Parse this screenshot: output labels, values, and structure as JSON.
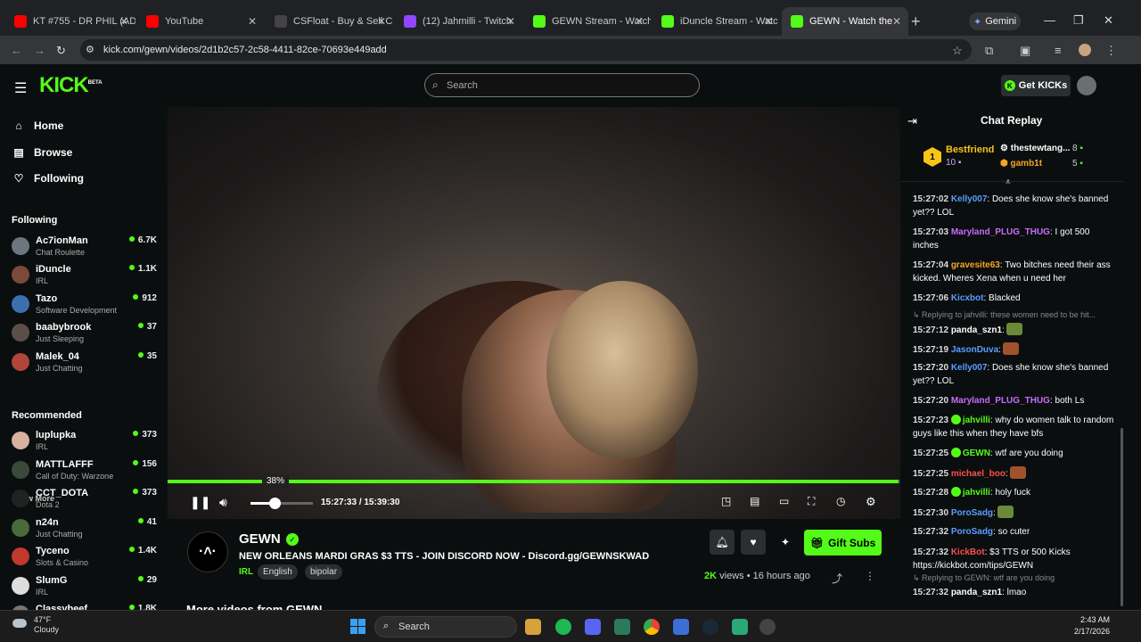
{
  "browser": {
    "tabs": [
      {
        "title": "KT #755 - DR PHIL (AD",
        "fav": "#ff0000"
      },
      {
        "title": "YouTube",
        "fav": "#ff0000"
      },
      {
        "title": "CSFloat - Buy & Sell CS",
        "fav": "#444444"
      },
      {
        "title": "(12) Jahmilli - Twitch",
        "fav": "#9146ff"
      },
      {
        "title": "GEWN Stream - Watch",
        "fav": "#53fc18"
      },
      {
        "title": "iDuncle Stream - Watc",
        "fav": "#53fc18"
      },
      {
        "title": "GEWN - Watch the",
        "fav": "#53fc18"
      }
    ],
    "gemini_label": "Gemini",
    "url": "kick.com/gewn/videos/2d1b2c57-2c58-4411-82ce-70693e449add"
  },
  "kick": {
    "logo": "KICK",
    "logo_beta": "BETA",
    "search_placeholder": "Search",
    "get_kicks_label": "Get KICKs",
    "brand_color": "#53fc18"
  },
  "sidebar": {
    "nav": [
      {
        "label": "Home",
        "icon": "home-icon"
      },
      {
        "label": "Browse",
        "icon": "browse-icon"
      },
      {
        "label": "Following",
        "icon": "heart-icon"
      }
    ],
    "following_header": "Following",
    "following": [
      {
        "name": "Ac7ionMan",
        "category": "Chat Roulette",
        "viewers": "6.7K",
        "color": "#6d7680"
      },
      {
        "name": "iDuncle",
        "category": "IRL",
        "viewers": "1.1K",
        "color": "#7a4b3a"
      },
      {
        "name": "Tazo",
        "category": "Software Development",
        "viewers": "912",
        "color": "#3d6fb0"
      },
      {
        "name": "baabybrook",
        "category": "Just Sleeping",
        "viewers": "37",
        "color": "#5a5048"
      },
      {
        "name": "Malek_04",
        "category": "Just Chatting",
        "viewers": "35",
        "color": "#b0453a"
      }
    ],
    "show_more_label": "Show More",
    "recommended_header": "Recommended",
    "recommended": [
      {
        "name": "luplupka",
        "category": "IRL",
        "viewers": "373",
        "color": "#d8b0a0"
      },
      {
        "name": "MATTLAFFF",
        "category": "Call of Duty: Warzone",
        "viewers": "156",
        "color": "#3a4a3a"
      },
      {
        "name": "CCT_DOTA",
        "category": "Dota 2",
        "viewers": "373",
        "color": "#222222"
      },
      {
        "name": "n24n",
        "category": "Just Chatting",
        "viewers": "41",
        "color": "#4a6a3a"
      },
      {
        "name": "Tyceno",
        "category": "Slots & Casino",
        "viewers": "1.4K",
        "color": "#c0392b"
      },
      {
        "name": "SlumG",
        "category": "IRL",
        "viewers": "29",
        "color": "#dddddd"
      },
      {
        "name": "Classybeef",
        "category": "",
        "viewers": "1.8K",
        "color": "#777777"
      }
    ]
  },
  "player": {
    "progress_fraction": 0.998,
    "volume_percent": 38,
    "volume_label": "38%",
    "time_current": "15:27:33",
    "time_separator": "/",
    "time_total": "15:39:30"
  },
  "video": {
    "channel": "GEWN",
    "avatar_text": "·˄·",
    "title": "NEW ORLEANS MARDI GRAS $3 TTS - JOIN DISCORD NOW - Discord.gg/GEWNSKWAD",
    "category": "IRL",
    "tags": [
      "English",
      "bipolar"
    ],
    "gift_subs_label": "Gift Subs",
    "views": "2K",
    "views_suffix": "views",
    "age": "16 hours ago",
    "more_videos_label": "More videos from GEWN"
  },
  "chat": {
    "title": "Chat Replay",
    "leaderboard": {
      "top_rank": "1",
      "top_name": "Bestfriend",
      "top_count": "10",
      "others": [
        {
          "name": "thestewtang...",
          "count": "8",
          "color": "#ffffff"
        },
        {
          "name": "gamb1t",
          "count": "5",
          "color": "#f5a623"
        }
      ]
    },
    "messages": [
      {
        "time": "15:27:02",
        "user": "Kelly007",
        "color": "#5b9cff",
        "text": ": Does she know she's banned yet?? LOL"
      },
      {
        "time": "15:27:03",
        "user": "Maryland_PLUG_THUG",
        "color": "#c86bff",
        "text": ": I got 500 inches"
      },
      {
        "time": "15:27:04",
        "user": "gravesite63",
        "color": "#f5a623",
        "text": ": Two bitches need their ass kicked. Wheres Xena when u need her"
      },
      {
        "time": "15:27:06",
        "user": "Kicxbot",
        "color": "#5b9cff",
        "text": ": Blacked"
      },
      {
        "reply": "Replying to jahvilli: these women need to be hit..."
      },
      {
        "time": "15:27:12",
        "user": "panda_szn1",
        "color": "#ffffff",
        "text": ":",
        "emote": "#6a8a3a"
      },
      {
        "time": "15:27:19",
        "user": "JasonDuva",
        "color": "#5b9cff",
        "text": ":",
        "emote": "#a0522d"
      },
      {
        "time": "15:27:20",
        "user": "Kelly007",
        "color": "#5b9cff",
        "text": ": Does she know she's banned yet?? LOL"
      },
      {
        "time": "15:27:20",
        "user": "Maryland_PLUG_THUG",
        "color": "#c86bff",
        "text": ": both Ls"
      },
      {
        "time": "15:27:23",
        "user": "jahvilli",
        "color": "#53fc18",
        "text": ": why do women talk to random guys like this when they have bfs"
      },
      {
        "time": "15:27:25",
        "user": "GEWN",
        "color": "#53fc18",
        "text": ": wtf are you doing"
      },
      {
        "time": "15:27:25",
        "user": "michael_boo",
        "color": "#ff4d4d",
        "text": ":",
        "emote": "#a0522d"
      },
      {
        "time": "15:27:28",
        "user": "jahvilli",
        "color": "#53fc18",
        "text": ": holy fuck"
      },
      {
        "time": "15:27:30",
        "user": "PoroSadg",
        "color": "#5b9cff",
        "text": ":",
        "emote": "#6a8a3a"
      },
      {
        "time": "15:27:32",
        "user": "PoroSadg",
        "color": "#5b9cff",
        "text": ": so cuter"
      },
      {
        "time": "15:27:32",
        "user": "KickBot",
        "color": "#ff4d4d",
        "text": ": $3 TTS or 500 Kicks https://kickbot.com/tips/GEWN"
      },
      {
        "reply": "Replying to GEWN: wtf are you doing"
      },
      {
        "time": "15:27:32",
        "user": "panda_szn1",
        "color": "#ffffff",
        "text": ": lmao"
      }
    ]
  },
  "taskbar": {
    "temp": "47°F",
    "condition": "Cloudy",
    "search_label": "Search",
    "time": "2:43 AM",
    "date": "2/17/2026"
  }
}
